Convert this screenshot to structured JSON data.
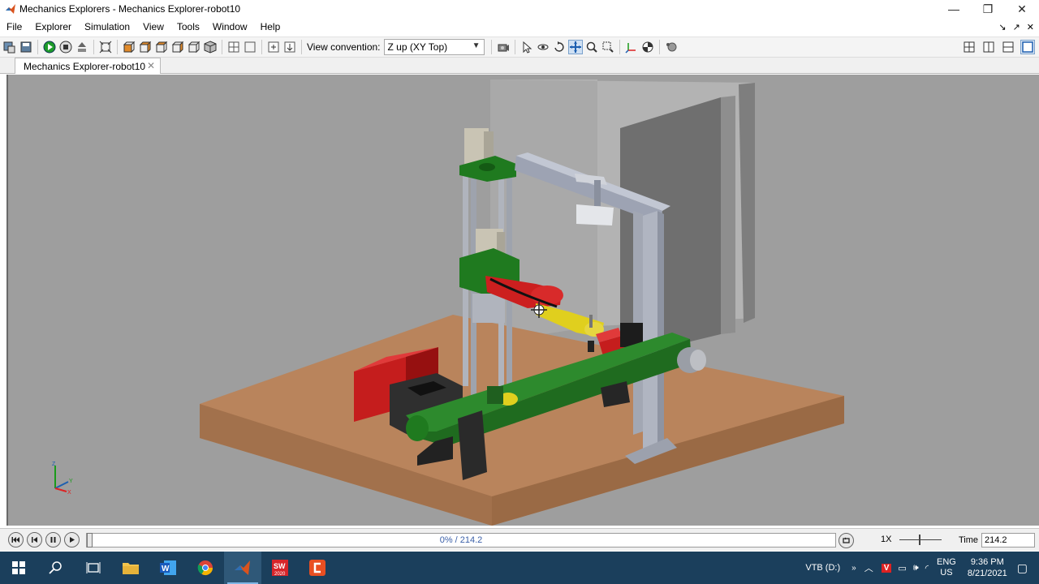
{
  "window": {
    "title": "Mechanics Explorers - Mechanics Explorer-robot10",
    "minimize": "—",
    "restore": "❐",
    "close": "✕"
  },
  "menu": {
    "items": [
      "File",
      "Explorer",
      "Simulation",
      "View",
      "Tools",
      "Window",
      "Help"
    ],
    "right_icons": [
      "↘",
      "↗",
      "✕"
    ]
  },
  "toolbar": {
    "view_convention_label": "View convention:",
    "view_convention_value": "Z up (XY Top)"
  },
  "tabs": [
    {
      "label": "Mechanics Explorer-robot10",
      "close": "✕"
    }
  ],
  "triad": {
    "z": "Z",
    "y": "Y",
    "x": "X"
  },
  "playback": {
    "progress_text": "0% / 214.2",
    "progress_fraction": 0,
    "speed": "1X",
    "time_label": "Time",
    "time_value": "214.2"
  },
  "taskbar": {
    "apps": [
      "windows-start",
      "search",
      "task-view",
      "file-explorer",
      "word",
      "chrome",
      "matlab",
      "solidworks-2020",
      "camtasia"
    ],
    "active_app": "matlab",
    "solidworks_badge": "2020",
    "drive": "VTB (D:)",
    "lang_top": "ENG",
    "lang_bottom": "US",
    "time": "9:36 PM",
    "date": "8/21/2021"
  },
  "colors": {
    "viewport_bg": "#9e9e9e",
    "floor": "#b9845c",
    "frame_green": "#1f7a1f",
    "arm_red": "#cc1f1f",
    "arm_yellow": "#e0cf1e",
    "taskbar": "#1b3f5c"
  }
}
